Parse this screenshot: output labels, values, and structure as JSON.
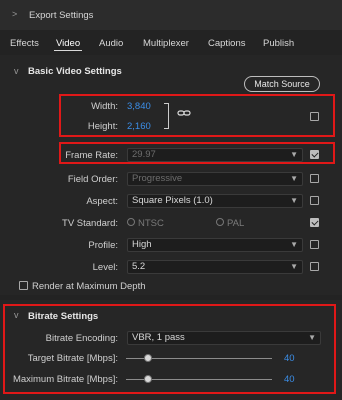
{
  "header": {
    "title": "Export Settings"
  },
  "tabs": [
    {
      "label": "Effects"
    },
    {
      "label": "Video",
      "active": true
    },
    {
      "label": "Audio"
    },
    {
      "label": "Multiplexer"
    },
    {
      "label": "Captions"
    },
    {
      "label": "Publish"
    }
  ],
  "basic": {
    "title": "Basic Video Settings",
    "match_source": "Match Source",
    "width_label": "Width:",
    "width_value": "3,840",
    "height_label": "Height:",
    "height_value": "2,160",
    "frame_rate_label": "Frame Rate:",
    "frame_rate_value": "29.97",
    "field_order_label": "Field Order:",
    "field_order_value": "Progressive",
    "aspect_label": "Aspect:",
    "aspect_value": "Square Pixels (1.0)",
    "tv_standard_label": "TV Standard:",
    "tv_ntsc": "NTSC",
    "tv_pal": "PAL",
    "profile_label": "Profile:",
    "profile_value": "High",
    "level_label": "Level:",
    "level_value": "5.2",
    "render_max_depth": "Render at Maximum Depth"
  },
  "bitrate": {
    "title": "Bitrate Settings",
    "encoding_label": "Bitrate Encoding:",
    "encoding_value": "VBR, 1 pass",
    "target_label": "Target Bitrate [Mbps]:",
    "target_value": "40",
    "max_label": "Maximum Bitrate [Mbps]:",
    "max_value": "40"
  },
  "colors": {
    "accent": "#3b8ee8",
    "highlight": "#e01818"
  }
}
